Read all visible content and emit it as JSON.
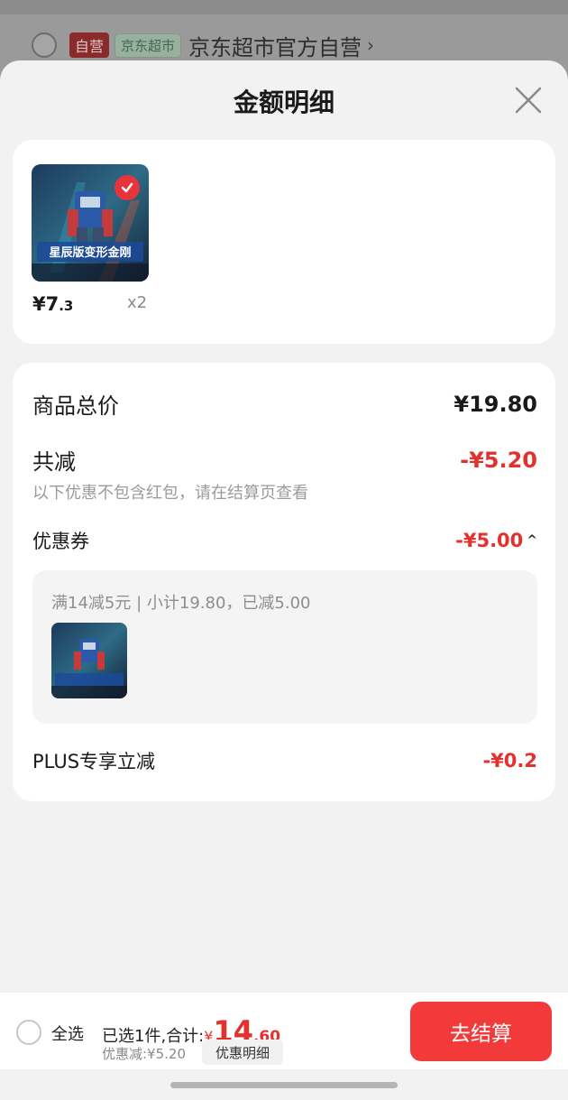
{
  "background_page": {
    "self_run_tag": "自营",
    "supermarket_tag": "京东超市",
    "shop_name": "京东超市官方自营",
    "chevron": "›"
  },
  "sheet": {
    "title": "金额明细"
  },
  "product": {
    "price_main": "¥7",
    "price_decimal": ".3",
    "quantity": "x2",
    "thumb_title": "星辰版变形金刚"
  },
  "breakdown": {
    "total_label": "商品总价",
    "total_value": "¥19.80",
    "reduce_label": "共减",
    "reduce_value": "-¥5.20",
    "note": "以下优惠不包含红包，请在结算页查看",
    "coupon_label": "优惠券",
    "coupon_value": "-¥5.00",
    "coupon_caret": "^",
    "coupon_desc": "满14减5元 | 小计19.80，已减5.00",
    "plus_label": "PLUS专享立减",
    "plus_value": "-¥0.2"
  },
  "bottom_bar": {
    "select_all": "全选",
    "selected_text": "已选1件,合计:",
    "currency": "¥",
    "total_int": "14",
    "total_dec": ".60",
    "discount_text": "优惠减:¥5.20",
    "detail_label": "优惠明细",
    "checkout_label": "去结算"
  },
  "colors": {
    "accent_red": "#e3312e",
    "checkout_red": "#f23a3a"
  }
}
